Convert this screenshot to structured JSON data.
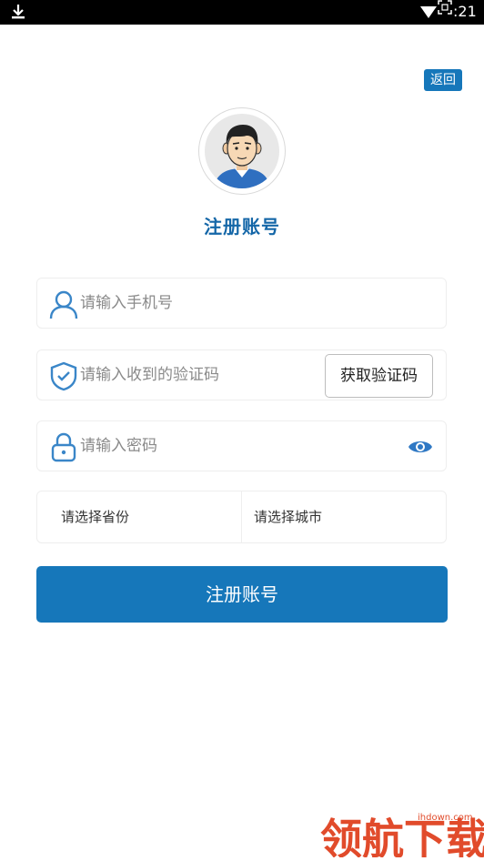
{
  "status_bar": {
    "time": ":21"
  },
  "header": {
    "back_label": "返回"
  },
  "title": "注册账号",
  "form": {
    "phone_placeholder": "请输入手机号",
    "code_placeholder": "请输入收到的验证码",
    "get_code_label": "获取验证码",
    "password_placeholder": "请输入密码",
    "province_label": "请选择省份",
    "city_label": "请选择城市",
    "submit_label": "注册账号"
  },
  "watermark": {
    "site": "ihdown.com",
    "logo_text": "领航下载"
  },
  "colors": {
    "accent": "#1677ba",
    "title": "#1567a8",
    "icon": "#3a86c8",
    "watermark": "#e14b2b"
  }
}
